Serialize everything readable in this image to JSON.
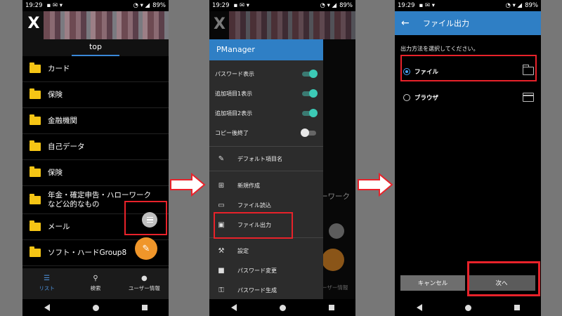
{
  "status": {
    "time": "19:29",
    "battery": "89%"
  },
  "phone1": {
    "logo": "X",
    "tab": "top",
    "folders": [
      {
        "label": "カード"
      },
      {
        "label": "保険"
      },
      {
        "label": "金融機関"
      },
      {
        "label": "自己データ"
      },
      {
        "label": "保険"
      },
      {
        "label": "年金・確定申告・ハローワーク\nなど公的なもの"
      },
      {
        "label": "メール"
      },
      {
        "label": "ソフト・ハードGroup8"
      }
    ],
    "bottom_tabs": [
      {
        "label": "リスト",
        "icon": "list-icon",
        "glyph": "☰",
        "active": true
      },
      {
        "label": "検索",
        "icon": "search-icon",
        "glyph": "⚲",
        "active": false
      },
      {
        "label": "ユーザー情報",
        "icon": "person-icon",
        "glyph": "●",
        "active": false
      }
    ]
  },
  "phone2": {
    "drawer_title": "PManager",
    "toggles": [
      {
        "label": "パスワード表示",
        "on": true
      },
      {
        "label": "追加項目1表示",
        "on": true
      },
      {
        "label": "追加項目2表示",
        "on": true
      },
      {
        "label": "コピー後終了",
        "on": false
      }
    ],
    "menu": [
      {
        "label": "デフォルト項目名",
        "icon": "pencil-icon",
        "glyph": "✎"
      },
      {
        "label": "新規作成",
        "icon": "new-folder-icon",
        "glyph": "⊞"
      },
      {
        "label": "ファイル読込",
        "icon": "folder-icon",
        "glyph": "▭"
      },
      {
        "label": "ファイル出力",
        "icon": "save-icon",
        "glyph": "▣"
      },
      {
        "label": "設定",
        "icon": "wrench-icon",
        "glyph": "⚒"
      },
      {
        "label": "パスワード変更",
        "icon": "lock-icon",
        "glyph": "■"
      },
      {
        "label": "パスワード生成",
        "icon": "key-icon",
        "glyph": "⚿"
      }
    ],
    "background_text": "ーワーク",
    "background_tab": "ーザー情報"
  },
  "phone3": {
    "title": "ファイル出力",
    "prompt": "出力方法を選択してください。",
    "options": [
      {
        "label": "ファイル",
        "selected": true,
        "icon": "folder-icon"
      },
      {
        "label": "ブラウザ",
        "selected": false,
        "icon": "browser-icon"
      }
    ],
    "cancel": "キャンセル",
    "next": "次へ"
  },
  "colors": {
    "accent": "#2f7fc5",
    "highlight": "#e8222a",
    "fab": "#f0962a",
    "folder": "#f5c515"
  }
}
